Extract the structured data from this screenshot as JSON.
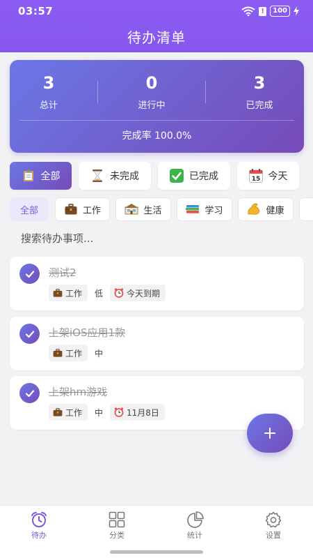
{
  "status_bar": {
    "time": "03:57",
    "battery": "100"
  },
  "header": {
    "title": "待办清单"
  },
  "stats": {
    "total": {
      "value": "3",
      "label": "总计"
    },
    "in_progress": {
      "value": "0",
      "label": "进行中"
    },
    "done": {
      "value": "3",
      "label": "已完成"
    },
    "rate_label": "完成率 100.0%"
  },
  "filter_tabs": [
    {
      "label": "全部",
      "icon": "clipboard-icon",
      "active": true
    },
    {
      "label": "未完成",
      "icon": "hourglass-icon",
      "active": false
    },
    {
      "label": "已完成",
      "icon": "check-box-icon",
      "active": false
    },
    {
      "label": "今天",
      "icon": "calendar-icon",
      "calendar_day": "15",
      "active": false
    }
  ],
  "categories": [
    {
      "label": "全部",
      "active": true
    },
    {
      "label": "工作",
      "icon": "briefcase-icon"
    },
    {
      "label": "生活",
      "icon": "house-icon"
    },
    {
      "label": "学习",
      "icon": "books-icon"
    },
    {
      "label": "健康",
      "icon": "flexed-arm-icon"
    }
  ],
  "search": {
    "placeholder": "搜索待办事项..."
  },
  "tasks": [
    {
      "title": "测试2",
      "category": "工作",
      "priority": "低",
      "due": "今天到期",
      "completed": true
    },
    {
      "title": "上架iOS应用1款",
      "category": "工作",
      "priority": "中",
      "due": "",
      "completed": true
    },
    {
      "title": "上架hm游戏",
      "category": "工作",
      "priority": "中",
      "due": "11月8日",
      "completed": true
    }
  ],
  "fab": {
    "label": "+"
  },
  "bottom_nav": [
    {
      "label": "待办",
      "icon": "alarm-clock-icon",
      "active": true
    },
    {
      "label": "分类",
      "icon": "grid-icon",
      "active": false
    },
    {
      "label": "统计",
      "icon": "pie-chart-icon",
      "active": false
    },
    {
      "label": "设置",
      "icon": "gear-icon",
      "active": false
    }
  ],
  "colors": {
    "accent": "#8b5cf6",
    "gradient_start": "#6b77e6",
    "gradient_end": "#764bb8"
  }
}
